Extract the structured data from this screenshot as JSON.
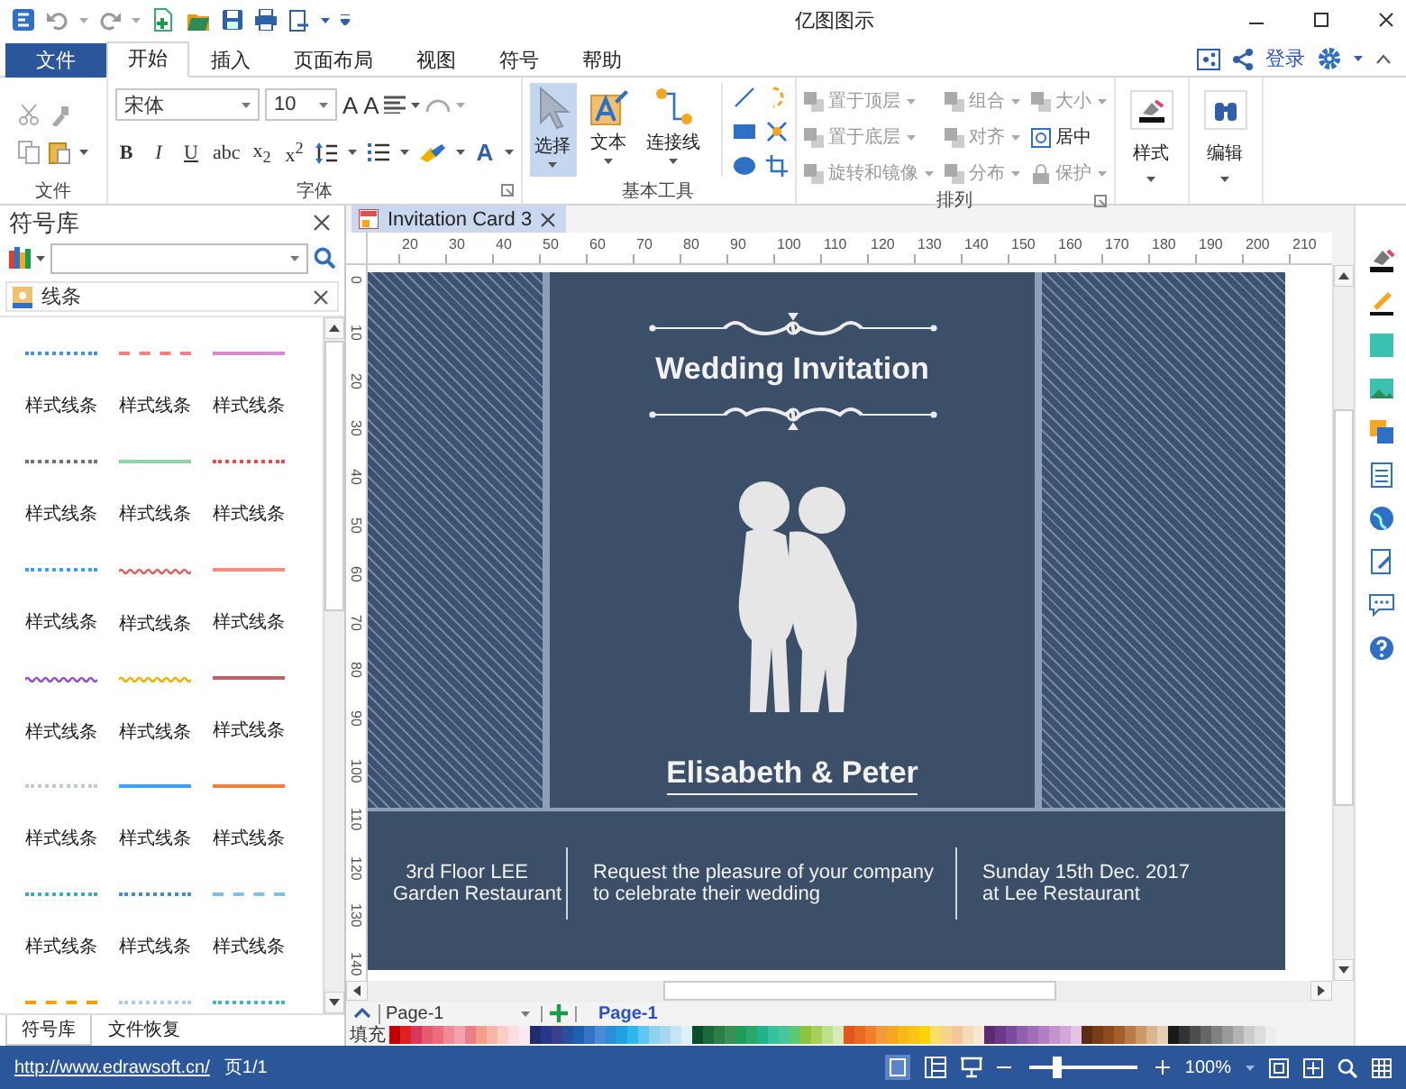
{
  "window": {
    "title": "亿图图示"
  },
  "menu_tabs": [
    {
      "label": "文件",
      "kind": "file",
      "selected": false
    },
    {
      "label": "开始",
      "kind": "tab",
      "selected": true
    },
    {
      "label": "插入",
      "kind": "tab",
      "selected": false
    },
    {
      "label": "页面布局",
      "kind": "tab",
      "selected": false
    },
    {
      "label": "视图",
      "kind": "tab",
      "selected": false
    },
    {
      "label": "符号",
      "kind": "tab",
      "selected": false
    },
    {
      "label": "帮助",
      "kind": "tab",
      "selected": false
    }
  ],
  "account": {
    "login": "登录"
  },
  "ribbon": {
    "groups": [
      {
        "kind": "clipboard",
        "label": "文件"
      },
      {
        "kind": "font",
        "label": "字体",
        "font": "宋体",
        "size": "10",
        "size_buttons": [
          "A",
          "A"
        ],
        "format_buttons": [
          "B",
          "I",
          "U",
          "abc",
          "x$_{2}$",
          "x$^{2}$"
        ],
        "color_button": "A"
      },
      {
        "kind": "tools",
        "label": "基本工具",
        "tools": [
          {
            "label": "选择",
            "selected": true
          },
          {
            "label": "文本",
            "selected": false
          },
          {
            "label": "连接线",
            "selected": false
          }
        ]
      },
      {
        "kind": "arrange",
        "label": "排列",
        "items": [
          {
            "label": "置于顶层",
            "disabled": true,
            "dropdown": true
          },
          {
            "label": "组合",
            "disabled": true,
            "dropdown": true
          },
          {
            "label": "大小",
            "disabled": true,
            "dropdown": true
          },
          {
            "label": "置于底层",
            "disabled": true,
            "dropdown": true
          },
          {
            "label": "对齐",
            "disabled": true,
            "dropdown": true
          },
          {
            "label": "居中",
            "disabled": false,
            "dropdown": false
          },
          {
            "label": "旋转和镜像",
            "disabled": true,
            "dropdown": true
          },
          {
            "label": "分布",
            "disabled": true,
            "dropdown": true
          },
          {
            "label": "保护",
            "disabled": true,
            "dropdown": true
          }
        ]
      },
      {
        "kind": "big",
        "button": "样式"
      },
      {
        "kind": "big",
        "button": "编辑"
      }
    ]
  },
  "symbols": {
    "title": "符号库",
    "category": "线条",
    "items": [
      {
        "label": "样式线条",
        "kind": "dotted",
        "color": "#4a90d9"
      },
      {
        "label": "样式线条",
        "kind": "dashed",
        "color": "#f08080"
      },
      {
        "label": "样式线条",
        "kind": "solid",
        "color": "#d48ed4"
      },
      {
        "label": "样式线条",
        "kind": "dotted",
        "color": "#707080"
      },
      {
        "label": "样式线条",
        "kind": "solid",
        "color": "#8fd4a8"
      },
      {
        "label": "样式线条",
        "kind": "dotted",
        "color": "#e05050"
      },
      {
        "label": "样式线条",
        "kind": "dotted",
        "color": "#3ea0e8"
      },
      {
        "label": "样式线条",
        "kind": "wavy",
        "color": "#e06060"
      },
      {
        "label": "样式线条",
        "kind": "solid",
        "color": "#f09080"
      },
      {
        "label": "样式线条",
        "kind": "wavy",
        "color": "#9050d0"
      },
      {
        "label": "样式线条",
        "kind": "wavy",
        "color": "#f0b000"
      },
      {
        "label": "样式线条",
        "kind": "solid",
        "color": "#c06060"
      },
      {
        "label": "样式线条",
        "kind": "dotted",
        "color": "#c0c8d0"
      },
      {
        "label": "样式线条",
        "kind": "solid",
        "color": "#40a0f0"
      },
      {
        "label": "样式线条",
        "kind": "solid",
        "color": "#f08040"
      },
      {
        "label": "样式线条",
        "kind": "dotted",
        "color": "#40a8b8"
      },
      {
        "label": "样式线条",
        "kind": "dotted",
        "color": "#4090d8"
      },
      {
        "label": "样式线条",
        "kind": "dashed",
        "color": "#80c0e8"
      },
      {
        "kind": "dashed",
        "color": "#f0a000"
      },
      {
        "kind": "dotted",
        "color": "#b0c8e0"
      },
      {
        "kind": "dotted",
        "color": "#40b8c0"
      }
    ],
    "tabs": [
      {
        "label": "符号库",
        "selected": true
      },
      {
        "label": "文件恢复",
        "selected": false
      }
    ]
  },
  "document": {
    "tab": "Invitation Card 3",
    "ruler": {
      "horizontal": [
        "20",
        "30",
        "40",
        "50",
        "60",
        "70",
        "80",
        "90",
        "100",
        "110",
        "120",
        "130",
        "140",
        "150",
        "160",
        "170",
        "180",
        "190",
        "200",
        "210"
      ],
      "vertical": [
        "0",
        "10",
        "20",
        "30",
        "40",
        "50",
        "60",
        "70",
        "80",
        "90",
        "100",
        "110",
        "120",
        "130",
        "140"
      ]
    },
    "card": {
      "title": "Wedding Invitation",
      "names": "Elisabeth & Peter",
      "details": [
        {
          "lines": [
            "3rd Floor LEE",
            "Garden Restaurant"
          ]
        },
        {
          "lines": [
            "Request the pleasure of your company",
            "to celebrate their wedding"
          ]
        },
        {
          "lines": [
            "Sunday 15th Dec. 2017",
            "at Lee Restaurant"
          ]
        }
      ]
    }
  },
  "pages": {
    "current": "Page-1",
    "tabs": [
      {
        "label": "Page-1",
        "selected": true
      }
    ]
  },
  "palette": {
    "label": "填充"
  },
  "status_bar": {
    "url": "http://www.edrawsoft.cn/",
    "page": "页1/1",
    "zoom": "100%",
    "zoom_slider": {
      "level": 0.25
    }
  }
}
